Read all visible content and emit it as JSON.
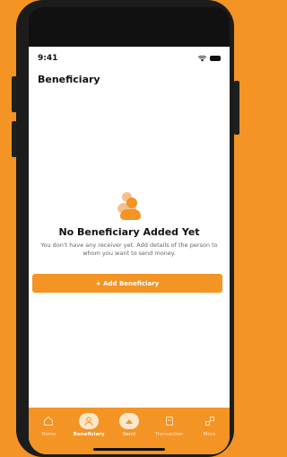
{
  "status": {
    "time": "9:41"
  },
  "header": {
    "title": "Beneficiary"
  },
  "empty_state": {
    "title": "No Beneficiary Added Yet",
    "description": "You don't have any receiver yet. Add details of the person to whom you want to send money.",
    "button_label": "+ Add Beneficiary"
  },
  "tabs": [
    {
      "label": "Home",
      "icon": "home-icon"
    },
    {
      "label": "Beneficiary",
      "icon": "person-icon"
    },
    {
      "label": "Send",
      "icon": "send-icon"
    },
    {
      "label": "Transaction",
      "icon": "receipt-icon"
    },
    {
      "label": "More",
      "icon": "grid-icon"
    }
  ],
  "colors": {
    "accent": "#F39424",
    "accent_light": "#F7C08A",
    "active_tab_bg": "#FFE7CC"
  }
}
